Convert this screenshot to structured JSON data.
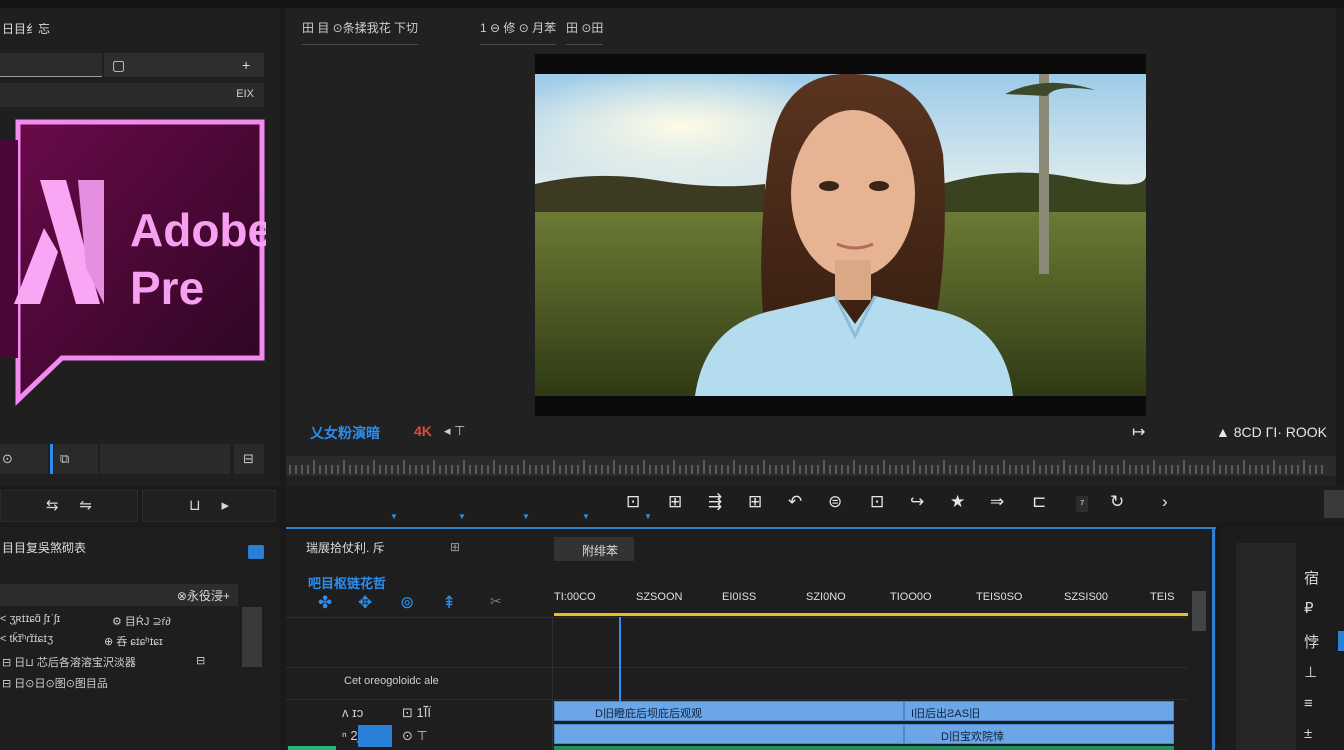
{
  "project_panel": {
    "title": "日目纟忘",
    "search_icons": [
      "▢",
      "+"
    ],
    "bar_label": "EIX",
    "logo": {
      "line1": "Adobe",
      "line2": "Pre"
    },
    "nav": [
      "⊙",
      "⧉",
      "⊟"
    ],
    "tools": [
      "⇆",
      "⇋",
      "⊔",
      "▸"
    ]
  },
  "effects_panel": {
    "title": "目目复吳煞砌表",
    "search_label": "⊗永役浸+",
    "rows": [
      "˂ ʒ̧ʀɪ̇ɪ̇ɕɑ̃ ʃɪˈʃɪ",
      "⚙ 目ŔJ ⊇ŕ∂",
      "˂ tǩɪ̃ʰɾɪ̃ɪ́ɕɪ̇ʒ",
      "⊕ 呑 ɕɪ̇ɕʰɪ̇ɕɪ",
      "⊟ 日⊔ 芯后各溶溶宝沢淡器",
      "⊟",
      "⊟ 日⊙日⊙图⊙图目品"
    ]
  },
  "monitor": {
    "tabs": [
      "田 目 ⊙条揉我花 下切",
      "1 ⊖ 修 ⊙ 月苯",
      "田 ⊙田"
    ],
    "timecode_left": "乂女粉演暗",
    "resolution": "4K",
    "res_tools": "◂ ⊤",
    "right_icon": "↦",
    "timecode_right": "▲ 8CD ΓI· ROOK"
  },
  "transport": {
    "buttons": [
      "⊡",
      "⊞",
      "⇶",
      "⊞",
      "↶",
      "⊜",
      "⊡",
      "↪",
      "★",
      "⇒",
      "⊏",
      "⁷",
      "↻",
      "›"
    ]
  },
  "timeline": {
    "header": "瑞展拾仗利. 斥",
    "header_icon": "⊞",
    "tab2_label": "附绯苯",
    "timecode": "吧目枢链花哲",
    "tools": [
      "✤",
      "✥",
      "⊚",
      "⇞",
      "✂"
    ],
    "ruler_labels": [
      "TI:00CO",
      "SZSOON",
      "EI0ISS",
      "SZI0NO",
      "TIOO0O",
      "TEIS0SO",
      "SZSIS00",
      "TEIS"
    ],
    "track_label": "Cet oreogoloidc ale",
    "tracks": [
      {
        "head": "ʌ ɪɔ",
        "icon": "⊡ 1Ǐ̃Ϊ"
      },
      {
        "head": "ⁿ 2ʃ",
        "icon": "⊙ ⊤"
      }
    ],
    "clips": [
      {
        "label": "D旧瞪庇后坝庇后观观"
      },
      {
        "label": "I旧后出ƧAS旧"
      },
      {
        "label": "D旧宝欢院悻"
      }
    ]
  },
  "right_panel": {
    "icons": [
      "宿",
      "₽",
      "悖",
      "⊥",
      "≡",
      "±"
    ]
  }
}
